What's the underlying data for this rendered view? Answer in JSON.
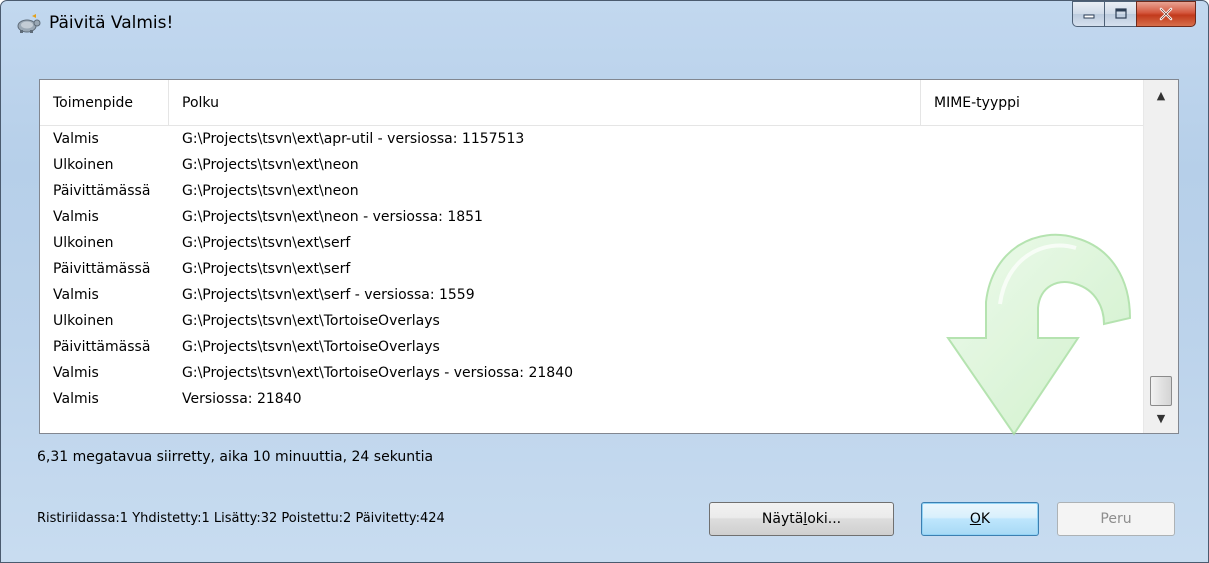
{
  "window": {
    "title": "Päivitä Valmis!"
  },
  "list": {
    "columns": [
      "Toimenpide",
      "Polku",
      "MIME-tyyppi"
    ],
    "rows": [
      {
        "action": "Valmis",
        "path": "G:\\Projects\\tsvn\\ext\\apr-util - versiossa: 1157513"
      },
      {
        "action": "Ulkoinen",
        "path": "G:\\Projects\\tsvn\\ext\\neon"
      },
      {
        "action": "Päivittämässä",
        "path": "G:\\Projects\\tsvn\\ext\\neon"
      },
      {
        "action": "Valmis",
        "path": "G:\\Projects\\tsvn\\ext\\neon - versiossa: 1851"
      },
      {
        "action": "Ulkoinen",
        "path": "G:\\Projects\\tsvn\\ext\\serf"
      },
      {
        "action": "Päivittämässä",
        "path": "G:\\Projects\\tsvn\\ext\\serf"
      },
      {
        "action": "Valmis",
        "path": "G:\\Projects\\tsvn\\ext\\serf - versiossa: 1559"
      },
      {
        "action": "Ulkoinen",
        "path": "G:\\Projects\\tsvn\\ext\\TortoiseOverlays"
      },
      {
        "action": "Päivittämässä",
        "path": "G:\\Projects\\tsvn\\ext\\TortoiseOverlays"
      },
      {
        "action": "Valmis",
        "path": "G:\\Projects\\tsvn\\ext\\TortoiseOverlays - versiossa: 21840"
      },
      {
        "action": "Valmis",
        "path": "Versiossa: 21840"
      }
    ]
  },
  "summary": "6,31 megatavua siirretty, aika 10 minuuttia, 24 sekuntia",
  "stats": "Ristiriidassa:1 Yhdistetty:1 Lisätty:32 Poistettu:2 Päivitetty:424",
  "buttons": {
    "log_pre": "Näytä ",
    "log_u": "l",
    "log_post": "oki...",
    "ok_u": "O",
    "ok_post": "K",
    "cancel": "Peru"
  },
  "icons": {
    "window": "tortoise-icon",
    "watermark": "update-arrow-icon",
    "accent": "#3c7fb1"
  }
}
